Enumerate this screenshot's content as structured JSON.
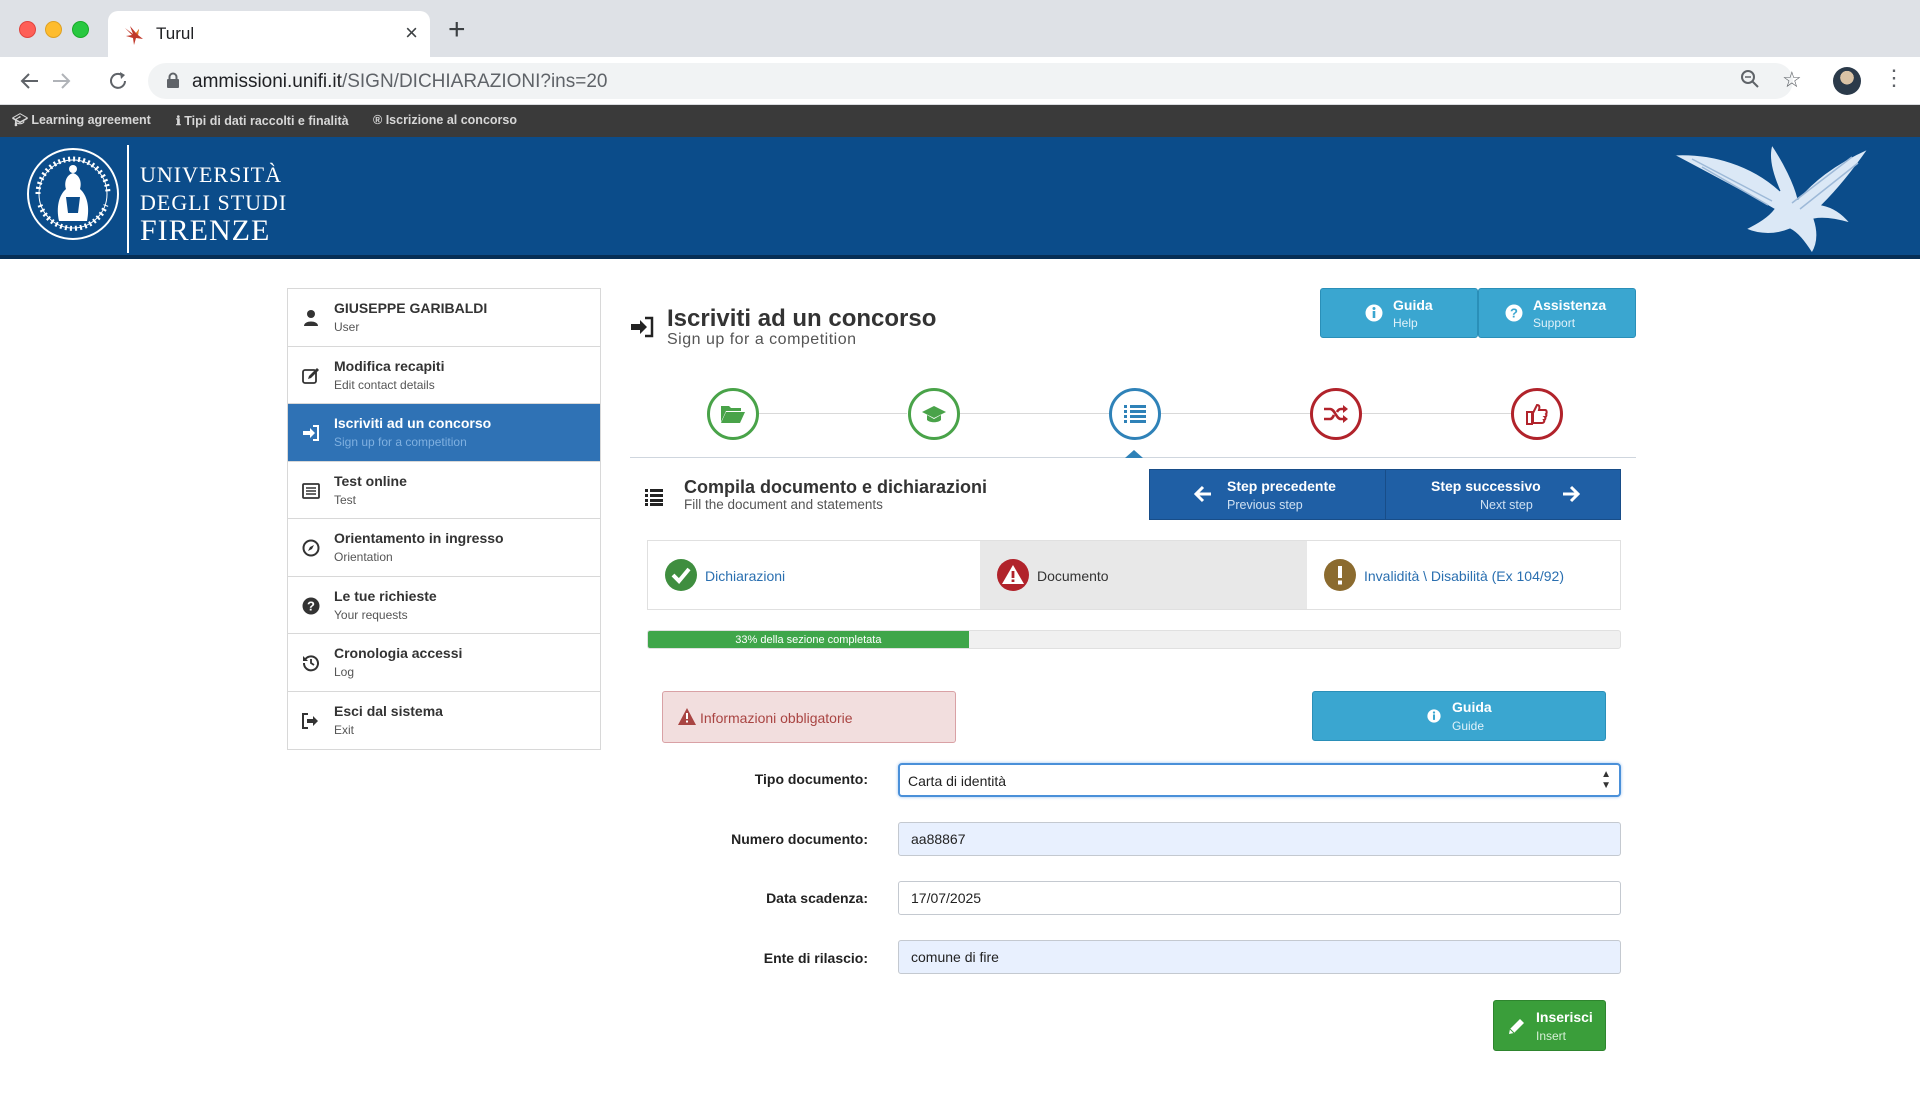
{
  "browser": {
    "tab_title": "Turul",
    "url_host": "ammissioni.unifi.it",
    "url_path": "/SIGN/DICHIARAZIONI?ins=20",
    "bookmarks": [
      "Learning agreement",
      "Tipi di dati raccolti e finalità",
      "Iscrizione al concorso"
    ]
  },
  "header": {
    "uni_line1": "UNIVERSITÀ",
    "uni_line2": "DEGLI STUDI",
    "uni_line3": "FIRENZE",
    "color": "#0b4c8a"
  },
  "sidebar": {
    "items": [
      {
        "label": "GIUSEPPE GARIBALDI",
        "sub": "User",
        "icon": "user-icon"
      },
      {
        "label": "Modifica recapiti",
        "sub": "Edit contact details",
        "icon": "edit-icon"
      },
      {
        "label": "Iscriviti ad un concorso",
        "sub": "Sign up for a competition",
        "icon": "sign-in-icon"
      },
      {
        "label": "Test online",
        "sub": "Test",
        "icon": "list-alt-icon"
      },
      {
        "label": "Orientamento in ingresso",
        "sub": "Orientation",
        "icon": "compass-icon"
      },
      {
        "label": "Le tue richieste",
        "sub": "Your requests",
        "icon": "question-icon"
      },
      {
        "label": "Cronologia accessi",
        "sub": "Log",
        "icon": "history-icon"
      },
      {
        "label": "Esci dal sistema",
        "sub": "Exit",
        "icon": "sign-out-icon"
      }
    ]
  },
  "main": {
    "title": "Iscriviti ad un concorso",
    "subtitle": "Sign up for a competition",
    "help": {
      "label": "Guida",
      "sub": "Help"
    },
    "support": {
      "label": "Assistenza",
      "sub": "Support"
    },
    "steps": [
      {
        "icon": "folder-open-icon",
        "color": "#49a349"
      },
      {
        "icon": "graduation-cap-icon",
        "color": "#49a349"
      },
      {
        "icon": "list-icon",
        "color": "#2f82b8"
      },
      {
        "icon": "shuffle-icon",
        "color": "#b1232b"
      },
      {
        "icon": "thumbs-up-icon",
        "color": "#b1232b"
      }
    ],
    "section_title": "Compila documento e dichiarazioni",
    "section_sub": "Fill the document and statements",
    "prev_step": {
      "label": "Step precedente",
      "sub": "Previous step"
    },
    "next_step": {
      "label": "Step successivo",
      "sub": "Next step"
    },
    "subtabs": [
      {
        "label": "Dichiarazioni",
        "status": "ok"
      },
      {
        "label": "Documento",
        "status": "error"
      },
      {
        "label": "Invalidità \\ Disabilità (Ex 104/92)",
        "status": "warning"
      }
    ],
    "progress": {
      "percent": 33,
      "label": "33% della sezione completata"
    },
    "alert": "Informazioni obbligatorie",
    "guide": {
      "label": "Guida",
      "sub": "Guide"
    },
    "form": {
      "tipo_label": "Tipo documento:",
      "tipo_value": "Carta di identità",
      "numero_label": "Numero documento:",
      "numero_value": "aa88867",
      "scadenza_label": "Data scadenza:",
      "scadenza_value": "17/07/2025",
      "ente_label": "Ente di rilascio:",
      "ente_value": "comune di fire"
    },
    "insert": {
      "label": "Inserisci",
      "sub": "Insert"
    }
  }
}
